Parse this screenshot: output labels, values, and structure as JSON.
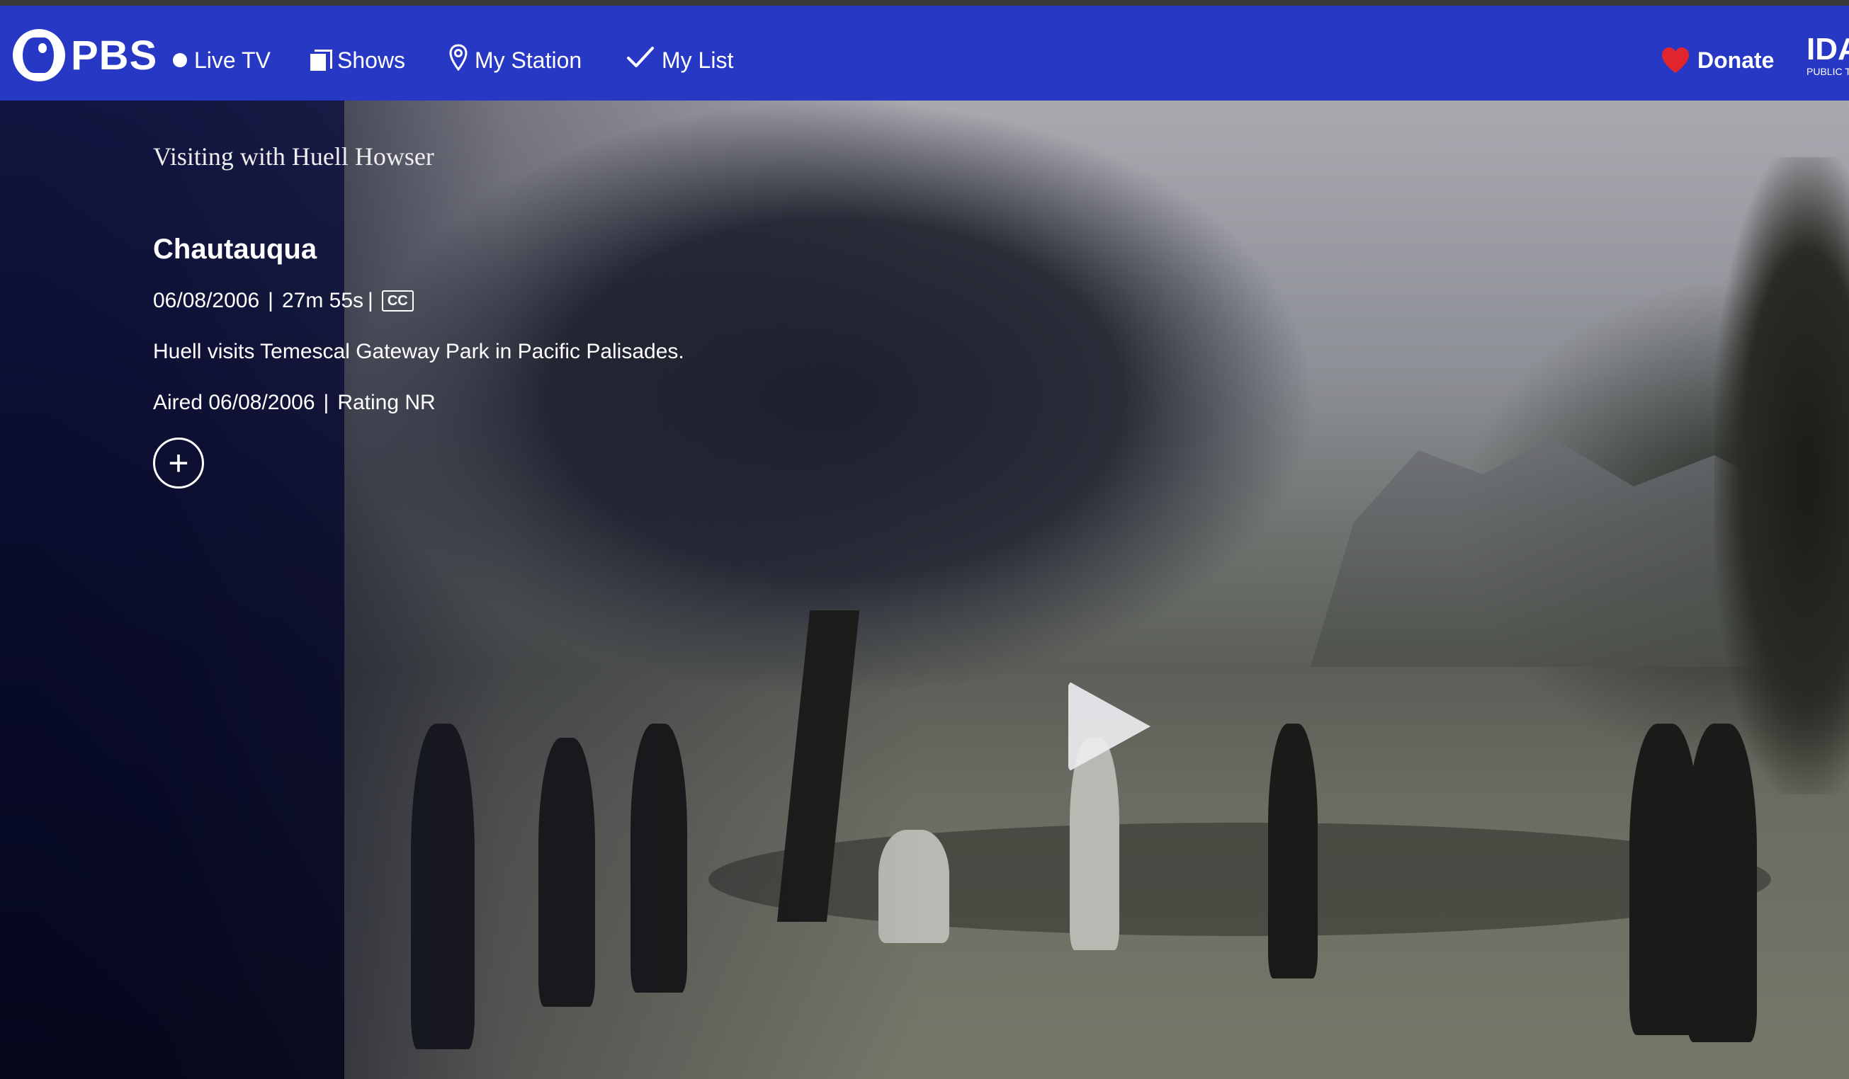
{
  "nav": {
    "logo_text": "PBS",
    "items": [
      {
        "label": "Live TV",
        "icon": "live-dot-icon"
      },
      {
        "label": "Shows",
        "icon": "shows-icon"
      },
      {
        "label": "My Station",
        "icon": "location-pin-icon"
      },
      {
        "label": "My List",
        "icon": "checkmark-icon"
      }
    ],
    "donate_label": "Donate",
    "station_name": "IDA",
    "station_sub": "PUBLIC T"
  },
  "episode": {
    "show_title": "Visiting with Huell Howser",
    "title": "Chautauqua",
    "date": "06/08/2006",
    "duration": "27m 55s",
    "cc_label": "CC",
    "description": "Huell visits Temescal Gateway Park in Pacific Palisades.",
    "aired": "Aired 06/08/2006",
    "rating": "Rating NR",
    "add_label": "+"
  },
  "colors": {
    "nav_bg": "#2638c4",
    "heart": "#e0262c"
  }
}
